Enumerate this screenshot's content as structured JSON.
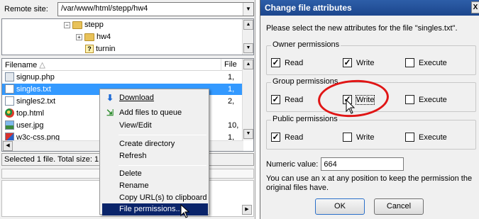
{
  "left": {
    "remote_label": "Remote site:",
    "remote_path": "/var/www/html/stepp/hw4",
    "tree": [
      {
        "label": "stepp",
        "expander": "−"
      },
      {
        "label": "hw4",
        "expander": "+"
      },
      {
        "label": "turnin",
        "expander": ""
      }
    ],
    "columns": {
      "filename": "Filename",
      "sort": "△",
      "filesize": "File"
    },
    "files": [
      {
        "name": "signup.php",
        "size": "1,",
        "icon": "php-file-icon",
        "selected": false
      },
      {
        "name": "singles.txt",
        "size": "1,",
        "icon": "text-file-icon",
        "selected": true
      },
      {
        "name": "singles2.txt",
        "size": "2,",
        "icon": "text-file-icon",
        "selected": false
      },
      {
        "name": "top.html",
        "size": "",
        "icon": "chrome-html-icon",
        "selected": false
      },
      {
        "name": "user.jpg",
        "size": "10,",
        "icon": "image-file-icon",
        "selected": false
      },
      {
        "name": "w3c-css.png",
        "size": "1,",
        "icon": "png-file-icon",
        "selected": false
      }
    ],
    "status": "Selected 1 file. Total size: 1"
  },
  "menu": {
    "items": [
      {
        "label": "Download",
        "icon": "download-arrow-icon",
        "underline": "D"
      },
      {
        "label": "Add files to queue",
        "icon": "add-queue-icon",
        "underline": "A"
      },
      {
        "label": "View/Edit",
        "icon": "",
        "underline": "V"
      },
      {
        "label": "Create directory",
        "icon": "",
        "underline": "C"
      },
      {
        "label": "Refresh",
        "icon": "",
        "underline": "f"
      },
      {
        "label": "Delete",
        "icon": "",
        "underline": "D"
      },
      {
        "label": "Rename",
        "icon": "",
        "underline": "R"
      },
      {
        "label": "Copy URL(s) to clipboard",
        "icon": "",
        "underline": "o"
      },
      {
        "label": "File permissions...",
        "icon": "",
        "underline": "F",
        "highlighted": true
      }
    ]
  },
  "dialog": {
    "title": "Change file attributes",
    "close": "X",
    "prompt": "Please select the new attributes for the file \"singles.txt\".",
    "groups": [
      {
        "title": "Owner permissions",
        "read": true,
        "write": true,
        "execute": false
      },
      {
        "title": "Group permissions",
        "read": true,
        "write": true,
        "execute": false
      },
      {
        "title": "Public permissions",
        "read": true,
        "write": false,
        "execute": false
      }
    ],
    "labels": {
      "read": "Read",
      "write": "Write",
      "execute": "Execute"
    },
    "numeric_label": "Numeric value:",
    "numeric_value": "664",
    "help": "You can use an x at any position to keep the permission the original files have.",
    "ok": "OK",
    "cancel": "Cancel"
  },
  "colors": {
    "selection": "#3399ff",
    "menu_highlight": "#0a246a",
    "annotation_ring": "#e01515"
  }
}
